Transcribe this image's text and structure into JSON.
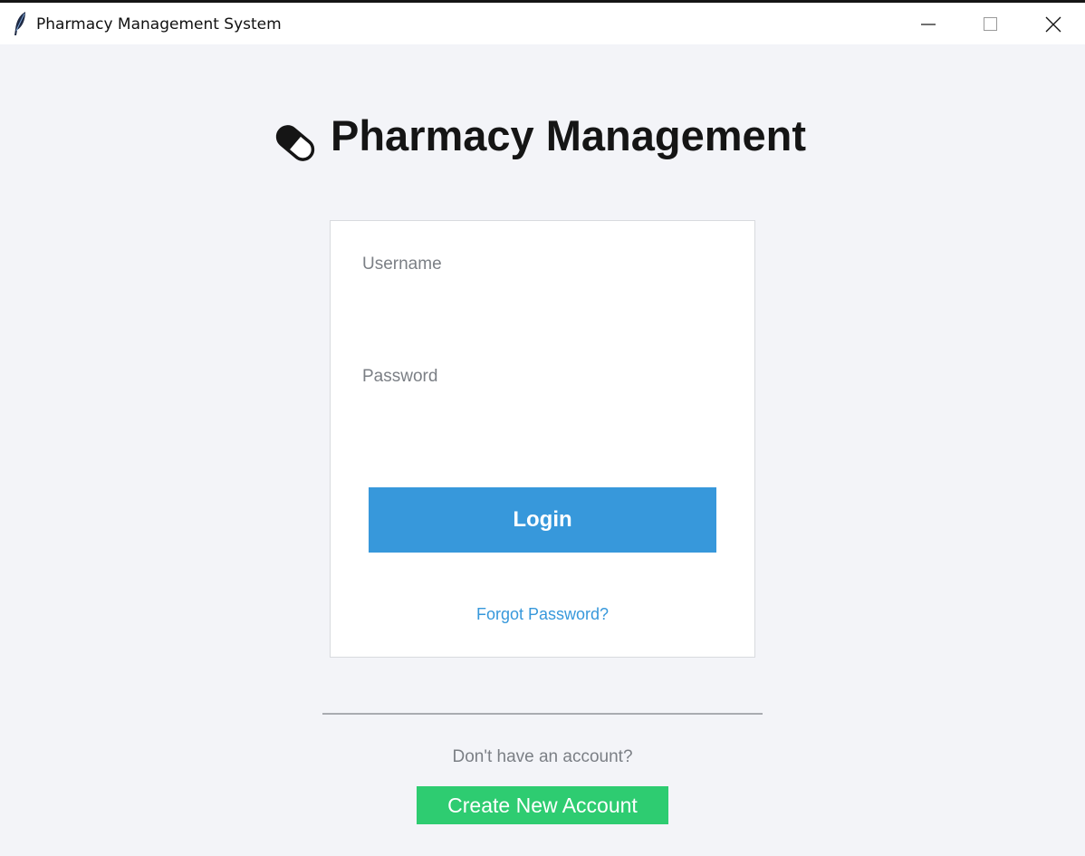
{
  "window": {
    "title": "Pharmacy Management System",
    "app_icon": "feather-icon",
    "controls": {
      "minimize": "minimize-icon",
      "maximize": "maximize-icon",
      "close": "close-icon"
    }
  },
  "header": {
    "icon": "pill-icon",
    "title": "Pharmacy Management"
  },
  "login_form": {
    "username_label": "Username",
    "username_value": "",
    "password_label": "Password",
    "password_value": "",
    "login_button": "Login",
    "forgot_password": "Forgot Password?"
  },
  "signup": {
    "prompt": "Don't have an account?",
    "create_button": "Create New Account"
  },
  "colors": {
    "background": "#f3f4f8",
    "primary": "#3798db",
    "success": "#2ecc71",
    "muted_text": "#7b7f85"
  }
}
